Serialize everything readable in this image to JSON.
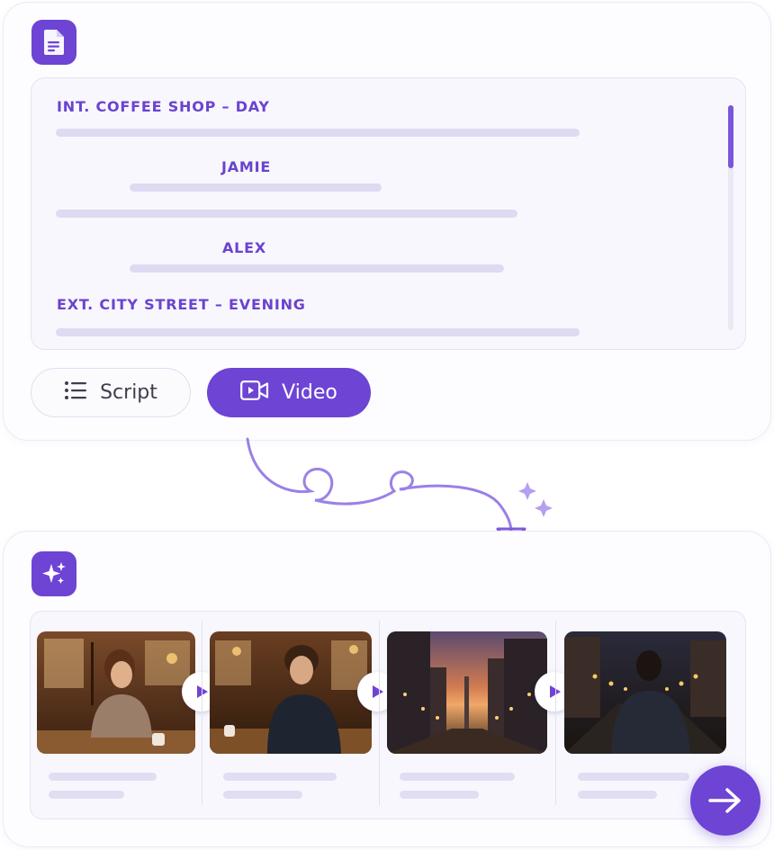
{
  "script": {
    "scene_1_heading": "INT. COFFEE SHOP – DAY",
    "character_1": "JAMIE",
    "character_2": "ALEX",
    "scene_2_heading": "EXT. CITY STREET – EVENING"
  },
  "mode_toggle": {
    "script_label": "Script",
    "video_label": "Video",
    "active": "Video"
  },
  "icons": {
    "document": "document-icon",
    "sparkle": "sparkle-icon",
    "list": "list-icon",
    "video_camera": "video-camera-icon",
    "play": "play-icon",
    "arrow_right": "arrow-right-icon"
  },
  "storyboard": {
    "frames": [
      {
        "scene": "woman at coffee shop table"
      },
      {
        "scene": "man at coffee shop table"
      },
      {
        "scene": "city street at sunset"
      },
      {
        "scene": "man walking on evening street"
      }
    ]
  },
  "colors": {
    "accent": "#6d44d4",
    "accent_text": "#6a43cf",
    "placeholder_line": "#dedaf2",
    "panel_bg": "#f8f7fd"
  }
}
